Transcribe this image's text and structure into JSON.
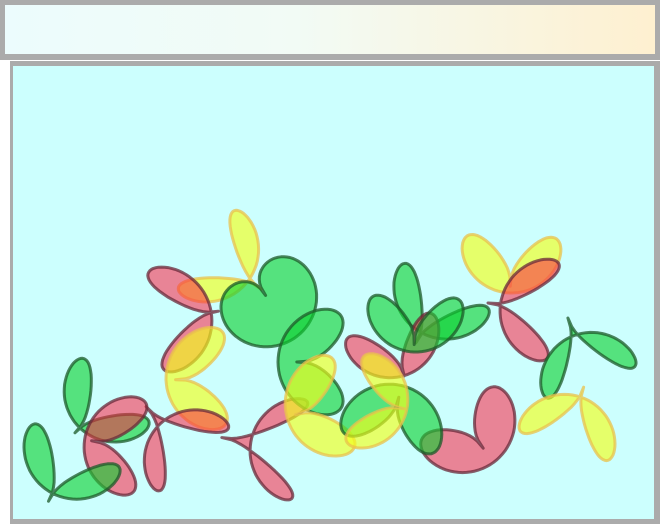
{
  "header": {
    "gradient_start": "#ecfcfd",
    "gradient_end": "#fef0d0"
  },
  "board": {
    "background": "#ccfffe",
    "frame_color": "#ababab"
  },
  "palette": {
    "red": {
      "fill": "#ff1f3f",
      "opacity": 0.55,
      "stroke": "#6a2a3a"
    },
    "green": {
      "fill": "#0bd12e",
      "opacity": 0.62,
      "stroke": "#1e5a2a"
    },
    "yellow": {
      "fill": "#f2ff1a",
      "opacity": 0.65,
      "stroke": "#e9c24c"
    }
  },
  "pieces": [
    {
      "color": "yellow"
    },
    {
      "color": "yellow"
    },
    {
      "color": "red"
    },
    {
      "color": "green"
    },
    {
      "color": "green"
    },
    {
      "color": "red"
    },
    {
      "color": "yellow"
    },
    {
      "color": "red"
    },
    {
      "color": "green"
    },
    {
      "color": "yellow"
    },
    {
      "color": "red"
    },
    {
      "color": "green"
    },
    {
      "color": "red"
    },
    {
      "color": "green"
    },
    {
      "color": "yellow"
    },
    {
      "color": "green"
    },
    {
      "color": "red"
    },
    {
      "color": "red"
    },
    {
      "color": "green"
    },
    {
      "color": "yellow"
    },
    {
      "color": "green"
    }
  ]
}
